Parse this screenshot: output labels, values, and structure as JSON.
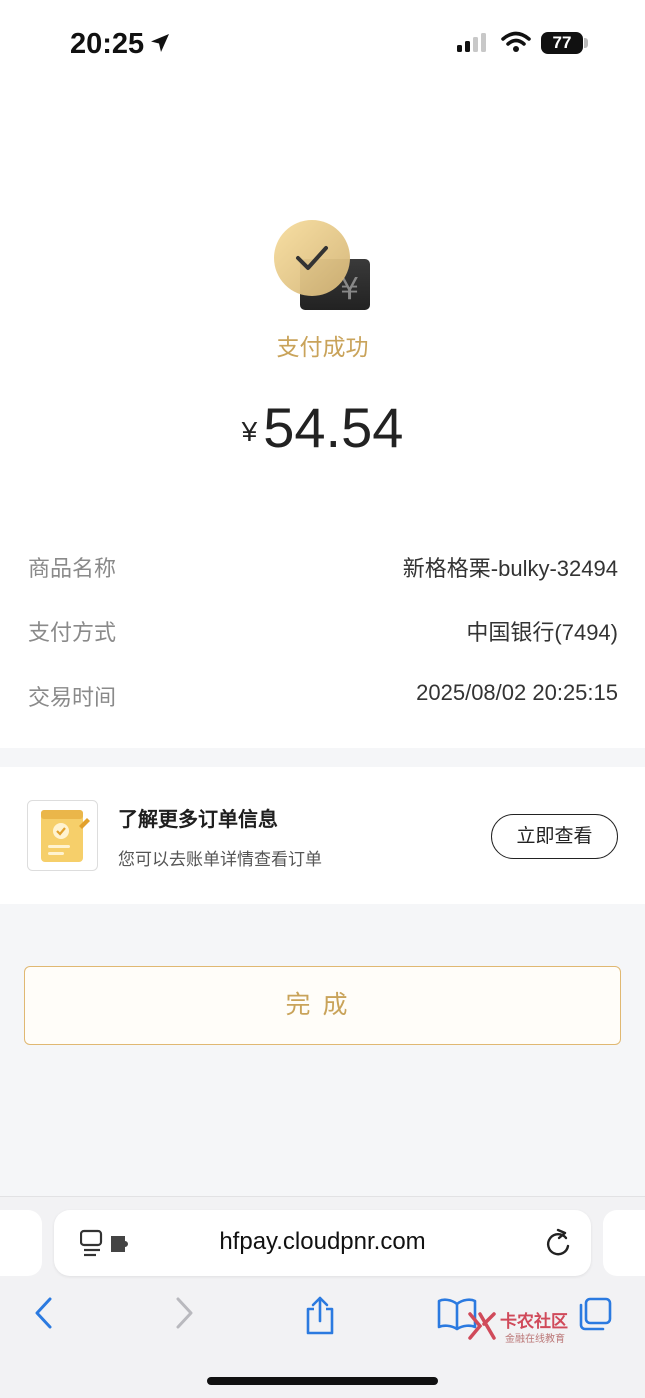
{
  "status_bar": {
    "time": "20:25",
    "battery": "77"
  },
  "payment": {
    "status_text": "支付成功",
    "currency_symbol": "¥",
    "amount": "54.54"
  },
  "details": [
    {
      "label": "商品名称",
      "value": "新格格栗-bulky-32494"
    },
    {
      "label": "支付方式",
      "value": "中国银行(7494)"
    },
    {
      "label": "交易时间",
      "value": "2025/08/02 20:25:15"
    }
  ],
  "order_card": {
    "title": "了解更多订单信息",
    "subtitle": "您可以去账单详情查看订单",
    "button_label": "立即查看"
  },
  "done_button": "完成",
  "browser": {
    "url": "hfpay.cloudpnr.com"
  },
  "watermark": {
    "main": "卡农社区",
    "sub": "金融在线教育"
  },
  "colors": {
    "accent_gold": "#c9a35a",
    "button_border": "#e0b872"
  },
  "icons": [
    "location-arrow-icon",
    "signal-icon",
    "wifi-icon",
    "battery-icon",
    "success-check-icon",
    "order-document-icon",
    "reader-mode-icon",
    "reload-icon",
    "back-icon",
    "forward-icon",
    "share-icon",
    "bookmarks-icon",
    "tabs-icon"
  ]
}
